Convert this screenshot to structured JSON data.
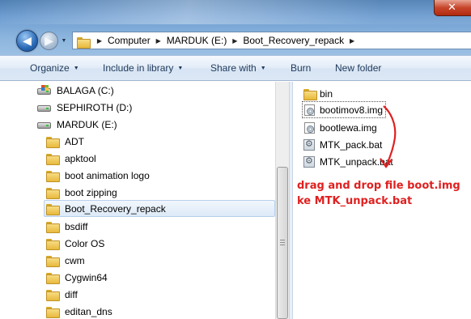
{
  "address_bar": {
    "crumbs": [
      "Computer",
      "MARDUK (E:)",
      "Boot_Recovery_repack"
    ]
  },
  "toolbar": {
    "organize": "Organize",
    "include_in_library": "Include in library",
    "share_with": "Share with",
    "burn": "Burn",
    "new_folder": "New folder"
  },
  "nav_pane": {
    "drives": [
      {
        "label": "BALAGA (C:)",
        "icon": "system-drive-icon"
      },
      {
        "label": "SEPHIROTH (D:)",
        "icon": "drive-icon"
      },
      {
        "label": "MARDUK (E:)",
        "icon": "drive-icon"
      }
    ],
    "folders": [
      {
        "label": "ADT"
      },
      {
        "label": "apktool"
      },
      {
        "label": "boot animation logo"
      },
      {
        "label": "boot zipping"
      },
      {
        "label": "Boot_Recovery_repack",
        "selected": true
      },
      {
        "label": "bsdiff"
      },
      {
        "label": "Color OS"
      },
      {
        "label": "cwm"
      },
      {
        "label": "Cygwin64"
      },
      {
        "label": "diff"
      },
      {
        "label": "editan_dns"
      }
    ]
  },
  "files": [
    {
      "name": "bin",
      "type": "folder"
    },
    {
      "name": "bootimov8.img",
      "type": "image",
      "focused": true
    },
    {
      "name": "bootlewa.img",
      "type": "image"
    },
    {
      "name": "MTK_pack.bat",
      "type": "batch"
    },
    {
      "name": "MTK_unpack.bat",
      "type": "batch"
    }
  ],
  "annotation": {
    "line1": "drag and drop file boot.img",
    "line2": "ke MTK_unpack.bat",
    "color": "#e02020"
  },
  "colors": {
    "title_bar": "#6e9dd1",
    "toolbar_text": "#1e395b",
    "selection": "#dce9f7"
  }
}
